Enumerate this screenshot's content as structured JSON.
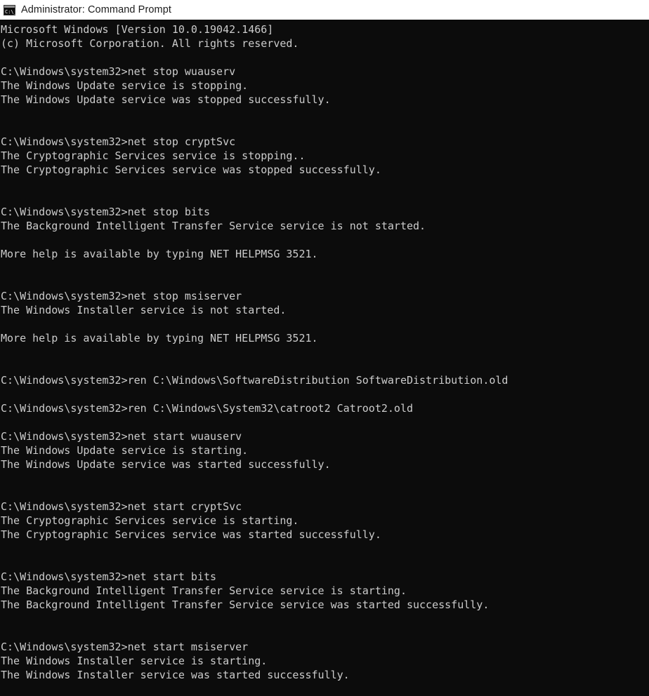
{
  "window": {
    "title": "Administrator: Command Prompt",
    "icon": "cmd-icon",
    "titlebar_bg": "#ffffff",
    "titlebar_fg": "#1b1b1b"
  },
  "console": {
    "background": "#0c0c0c",
    "foreground": "#cccccc",
    "prompt": "C:\\Windows\\system32>",
    "lines": [
      "Microsoft Windows [Version 10.0.19042.1466]",
      "(c) Microsoft Corporation. All rights reserved.",
      "",
      "C:\\Windows\\system32>net stop wuauserv",
      "The Windows Update service is stopping.",
      "The Windows Update service was stopped successfully.",
      "",
      "",
      "C:\\Windows\\system32>net stop cryptSvc",
      "The Cryptographic Services service is stopping..",
      "The Cryptographic Services service was stopped successfully.",
      "",
      "",
      "C:\\Windows\\system32>net stop bits",
      "The Background Intelligent Transfer Service service is not started.",
      "",
      "More help is available by typing NET HELPMSG 3521.",
      "",
      "",
      "C:\\Windows\\system32>net stop msiserver",
      "The Windows Installer service is not started.",
      "",
      "More help is available by typing NET HELPMSG 3521.",
      "",
      "",
      "C:\\Windows\\system32>ren C:\\Windows\\SoftwareDistribution SoftwareDistribution.old",
      "",
      "C:\\Windows\\system32>ren C:\\Windows\\System32\\catroot2 Catroot2.old",
      "",
      "C:\\Windows\\system32>net start wuauserv",
      "The Windows Update service is starting.",
      "The Windows Update service was started successfully.",
      "",
      "",
      "C:\\Windows\\system32>net start cryptSvc",
      "The Cryptographic Services service is starting.",
      "The Cryptographic Services service was started successfully.",
      "",
      "",
      "C:\\Windows\\system32>net start bits",
      "The Background Intelligent Transfer Service service is starting.",
      "The Background Intelligent Transfer Service service was started successfully.",
      "",
      "",
      "C:\\Windows\\system32>net start msiserver",
      "The Windows Installer service is starting.",
      "The Windows Installer service was started successfully."
    ]
  }
}
